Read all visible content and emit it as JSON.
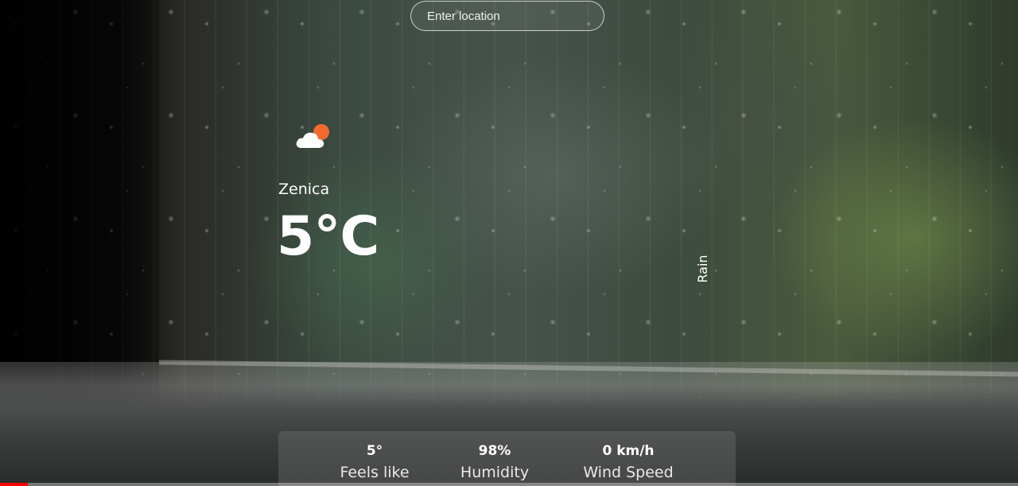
{
  "search": {
    "placeholder": "Enter location",
    "value": ""
  },
  "weather": {
    "icon": "cloud-sun-icon",
    "city": "Zenica",
    "temperature": "5°C",
    "description": "Rain"
  },
  "stats": {
    "feels_like": {
      "value": "5°",
      "label": "Feels like"
    },
    "humidity": {
      "value": "98%",
      "label": "Humidity"
    },
    "wind_speed": {
      "value": "0 km/h",
      "label": "Wind Speed"
    }
  },
  "video_progress": {
    "fraction": 0.027,
    "color": "#ff0000"
  },
  "colors": {
    "text": "#ffffff",
    "sun": "#f26a2e"
  }
}
